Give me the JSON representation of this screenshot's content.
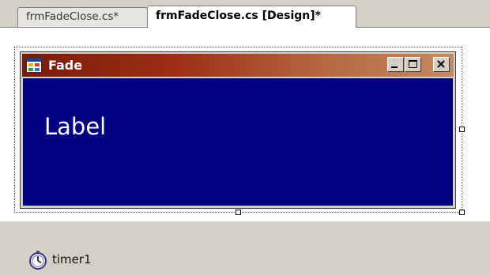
{
  "tabs": [
    {
      "label": "frmFadeClose.cs*",
      "active": false
    },
    {
      "label": "frmFadeClose.cs [Design]*",
      "active": true
    }
  ],
  "form": {
    "title": "Fade",
    "title_icon": "form-icon",
    "client_color": "#000080",
    "title_gradient": [
      "#7a1a0e",
      "#c48a62"
    ],
    "buttons": [
      "minimize-icon",
      "maximize-icon",
      "close-icon"
    ],
    "label_text": "Label"
  },
  "tray": {
    "components": [
      {
        "name": "timer1",
        "icon": "stopwatch-icon"
      }
    ]
  }
}
